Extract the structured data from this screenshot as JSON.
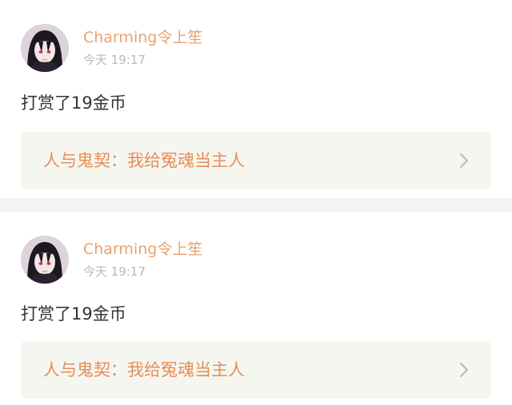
{
  "posts": [
    {
      "username": "Charming令上笙",
      "time": "今天 19:17",
      "content": "打赏了19金币",
      "book_link": "人与鬼契：我给冤魂当主人"
    },
    {
      "username": "Charming令上笙",
      "time": "今天 19:17",
      "content": "打赏了19金币",
      "book_link": "人与鬼契：我给冤魂当主人"
    }
  ],
  "icons": {
    "avatar": "anime-girl-avatar",
    "chevron": "chevron-right-icon"
  },
  "colors": {
    "username": "#e9a26d",
    "link_text": "#e48f55",
    "time": "#b9b9b9",
    "link_bg": "#f6f6f1",
    "divider": "#f4f4f4"
  }
}
